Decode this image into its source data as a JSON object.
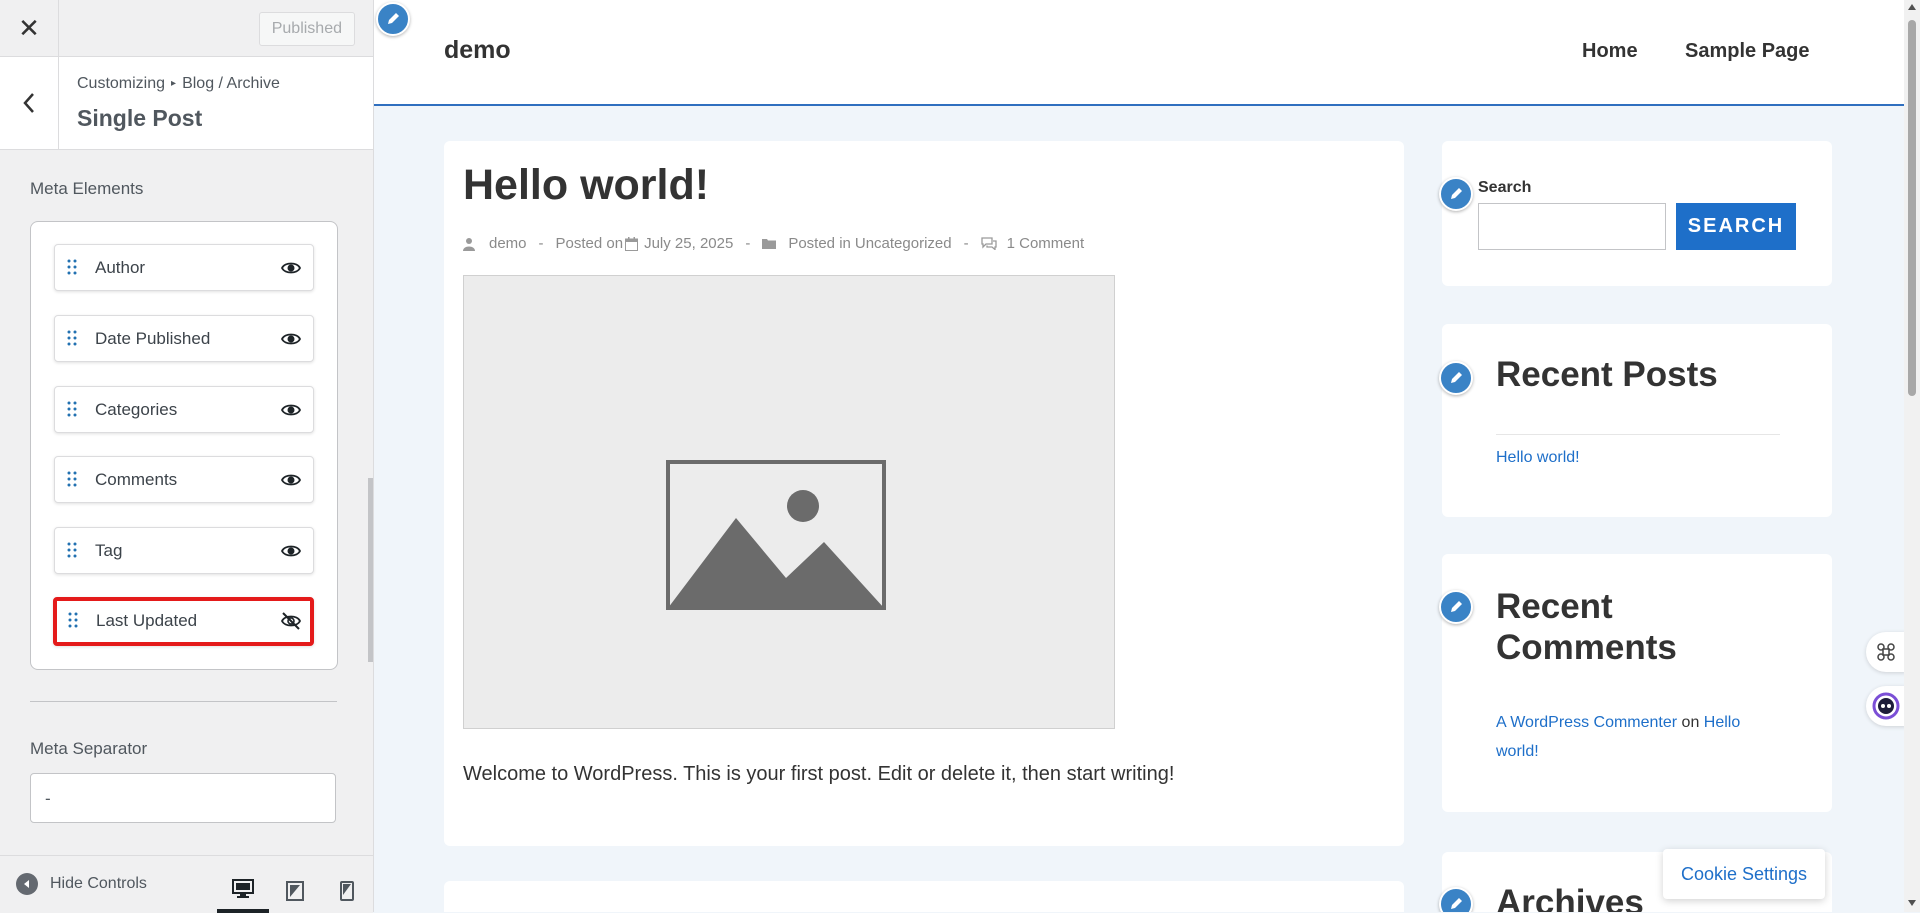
{
  "customizer": {
    "close_symbol": "✕",
    "published_label": "Published",
    "breadcrumb": {
      "root": "Customizing",
      "separator": "▸",
      "parent": "Blog / Archive"
    },
    "section_title": "Single Post",
    "meta_elements_label": "Meta Elements",
    "meta_items": [
      {
        "label": "Author",
        "visible": true
      },
      {
        "label": "Date Published",
        "visible": true
      },
      {
        "label": "Categories",
        "visible": true
      },
      {
        "label": "Comments",
        "visible": true
      },
      {
        "label": "Tag",
        "visible": true
      },
      {
        "label": "Last Updated",
        "visible": false,
        "highlighted": true
      }
    ],
    "meta_separator_label": "Meta Separator",
    "meta_separator_value": "-",
    "hide_controls_label": "Hide Controls",
    "devices": [
      "desktop",
      "tablet",
      "mobile"
    ],
    "active_device": "desktop"
  },
  "site": {
    "title": "demo",
    "nav": [
      "Home",
      "Sample Page"
    ],
    "accent": "#1e6fc9"
  },
  "post": {
    "title": "Hello world!",
    "meta": {
      "author": "demo",
      "posted_on_prefix": "Posted on",
      "date": "July 25, 2025",
      "posted_in_prefix": "Posted in",
      "category": "Uncategorized",
      "comments": "1 Comment",
      "separator": "-"
    },
    "excerpt": "Welcome to WordPress. This is your first post. Edit or delete it, then start writing!"
  },
  "sidebar": {
    "search_label": "Search",
    "search_button": "SEARCH",
    "recent_posts_title": "Recent Posts",
    "recent_posts": [
      "Hello world!"
    ],
    "recent_comments_title_line1": "Recent",
    "recent_comments_title_line2": "Comments",
    "recent_comment": {
      "author": "A WordPress Commenter",
      "on": "on",
      "post_line1": "Hello",
      "post_line2": "world!"
    },
    "archives_title": "Archives"
  },
  "cookie_settings_label": "Cookie Settings"
}
